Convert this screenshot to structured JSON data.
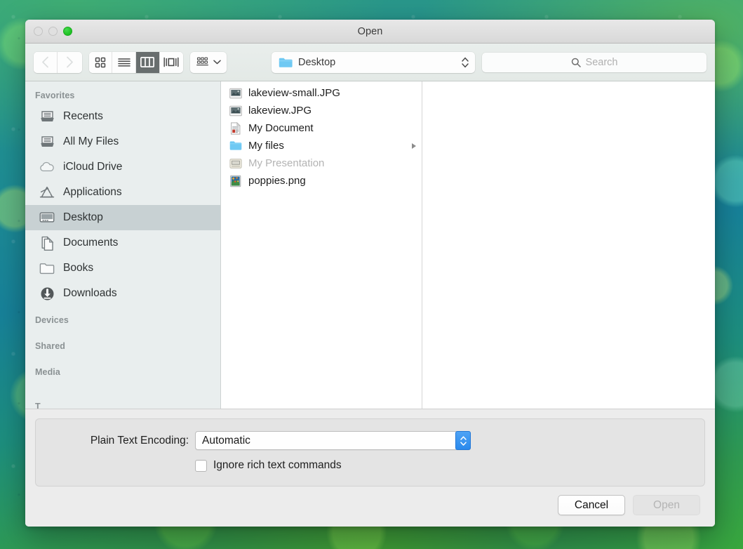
{
  "window": {
    "title": "Open",
    "traffic_lights": [
      {
        "name": "close",
        "state": "disabled"
      },
      {
        "name": "minimize",
        "state": "disabled"
      },
      {
        "name": "zoom",
        "state": "enabled",
        "color": "#22c427"
      }
    ]
  },
  "toolbar": {
    "nav": [
      {
        "icon": "chevron-left-icon",
        "label": "Back",
        "enabled": false
      },
      {
        "icon": "chevron-right-icon",
        "label": "Forward",
        "enabled": false
      }
    ],
    "view_modes": [
      {
        "icon": "icon-view-icon",
        "label": "Icon View",
        "selected": false
      },
      {
        "icon": "list-view-icon",
        "label": "List View",
        "selected": false
      },
      {
        "icon": "column-view-icon",
        "label": "Column View",
        "selected": true
      },
      {
        "icon": "coverflow-view-icon",
        "label": "Cover Flow View",
        "selected": false
      }
    ],
    "arrange": {
      "icon": "arrange-icon",
      "chevron": "chevron-down-icon",
      "label": "Arrange By"
    },
    "path_popup": {
      "icon": "folder-icon",
      "label": "Desktop",
      "chevron": "updown-chevron-icon"
    },
    "search": {
      "icon": "search-icon",
      "placeholder": "Search",
      "value": ""
    }
  },
  "sidebar": {
    "sections": [
      {
        "header": "Favorites",
        "items": [
          {
            "label": "Recents",
            "icon": "recents-icon",
            "selected": false
          },
          {
            "label": "All My Files",
            "icon": "all-my-files-icon",
            "selected": false
          },
          {
            "label": "iCloud Drive",
            "icon": "icloud-icon",
            "selected": false
          },
          {
            "label": "Applications",
            "icon": "applications-icon",
            "selected": false
          },
          {
            "label": "Desktop",
            "icon": "desktop-icon",
            "selected": true
          },
          {
            "label": "Documents",
            "icon": "documents-icon",
            "selected": false
          },
          {
            "label": "Books",
            "icon": "folder-icon",
            "selected": false
          },
          {
            "label": "Downloads",
            "icon": "downloads-icon",
            "selected": false
          }
        ]
      },
      {
        "header": "Devices",
        "items": []
      },
      {
        "header": "Shared",
        "items": []
      },
      {
        "header": "Media",
        "items": []
      },
      {
        "header": "T",
        "items": [],
        "clipped": true
      }
    ]
  },
  "file_list": {
    "items": [
      {
        "name": "lakeview-small.JPG",
        "icon": "image-file-icon",
        "dimmed": false,
        "has_children": false
      },
      {
        "name": "lakeview.JPG",
        "icon": "image-file-icon",
        "dimmed": false,
        "has_children": false
      },
      {
        "name": "My Document",
        "icon": "document-file-icon",
        "dimmed": false,
        "has_children": false
      },
      {
        "name": "My files",
        "icon": "folder-icon",
        "dimmed": false,
        "has_children": true
      },
      {
        "name": "My Presentation",
        "icon": "presentation-file-icon",
        "dimmed": true,
        "has_children": false
      },
      {
        "name": "poppies.png",
        "icon": "poppies-file-icon",
        "dimmed": false,
        "has_children": false
      }
    ]
  },
  "accessory": {
    "encoding_label": "Plain Text Encoding:",
    "encoding_value": "Automatic",
    "ignore_rich_text": {
      "label": "Ignore rich text commands",
      "checked": false
    }
  },
  "footer": {
    "cancel_label": "Cancel",
    "open_label": "Open",
    "open_enabled": false
  }
}
